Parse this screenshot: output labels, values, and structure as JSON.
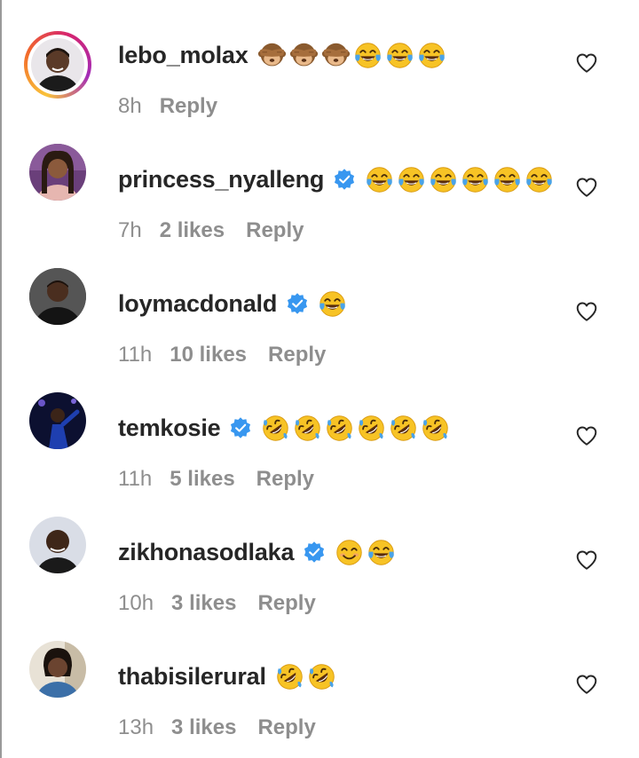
{
  "comments": [
    {
      "username": "lebo_molax",
      "verified": false,
      "story_ring": true,
      "emojis": [
        "see-no-evil-monkey",
        "see-no-evil-monkey",
        "see-no-evil-monkey",
        "face-with-tears-of-joy",
        "face-with-tears-of-joy",
        "face-with-tears-of-joy"
      ],
      "time": "8h",
      "likes": "",
      "reply": "Reply"
    },
    {
      "username": "princess_nyalleng",
      "verified": true,
      "story_ring": false,
      "emojis": [
        "face-with-tears-of-joy",
        "face-with-tears-of-joy",
        "face-with-tears-of-joy",
        "face-with-tears-of-joy",
        "face-with-tears-of-joy",
        "face-with-tears-of-joy"
      ],
      "time": "7h",
      "likes": "2 likes",
      "reply": "Reply"
    },
    {
      "username": "loymacdonald",
      "verified": true,
      "story_ring": false,
      "emojis": [
        "face-with-tears-of-joy"
      ],
      "time": "11h",
      "likes": "10 likes",
      "reply": "Reply"
    },
    {
      "username": "temkosie",
      "verified": true,
      "story_ring": false,
      "emojis": [
        "rolling-on-floor-laughing",
        "rolling-on-floor-laughing",
        "rolling-on-floor-laughing",
        "rolling-on-floor-laughing",
        "rolling-on-floor-laughing",
        "rolling-on-floor-laughing"
      ],
      "time": "11h",
      "likes": "5 likes",
      "reply": "Reply"
    },
    {
      "username": "zikhonasodlaka",
      "verified": true,
      "story_ring": false,
      "emojis": [
        "smiling-face-with-smiling-eyes",
        "face-with-tears-of-joy"
      ],
      "time": "10h",
      "likes": "3 likes",
      "reply": "Reply"
    },
    {
      "username": "thabisilerural",
      "verified": false,
      "story_ring": false,
      "emojis": [
        "rolling-on-floor-laughing",
        "rolling-on-floor-laughing"
      ],
      "time": "13h",
      "likes": "3 likes",
      "reply": "Reply"
    }
  ],
  "colors": {
    "username": "#262626",
    "meta": "#8e8e8e",
    "verified": "#3897f0",
    "emoji_yellow": "#f7c325",
    "emoji_tears": "#4aa3e8"
  }
}
